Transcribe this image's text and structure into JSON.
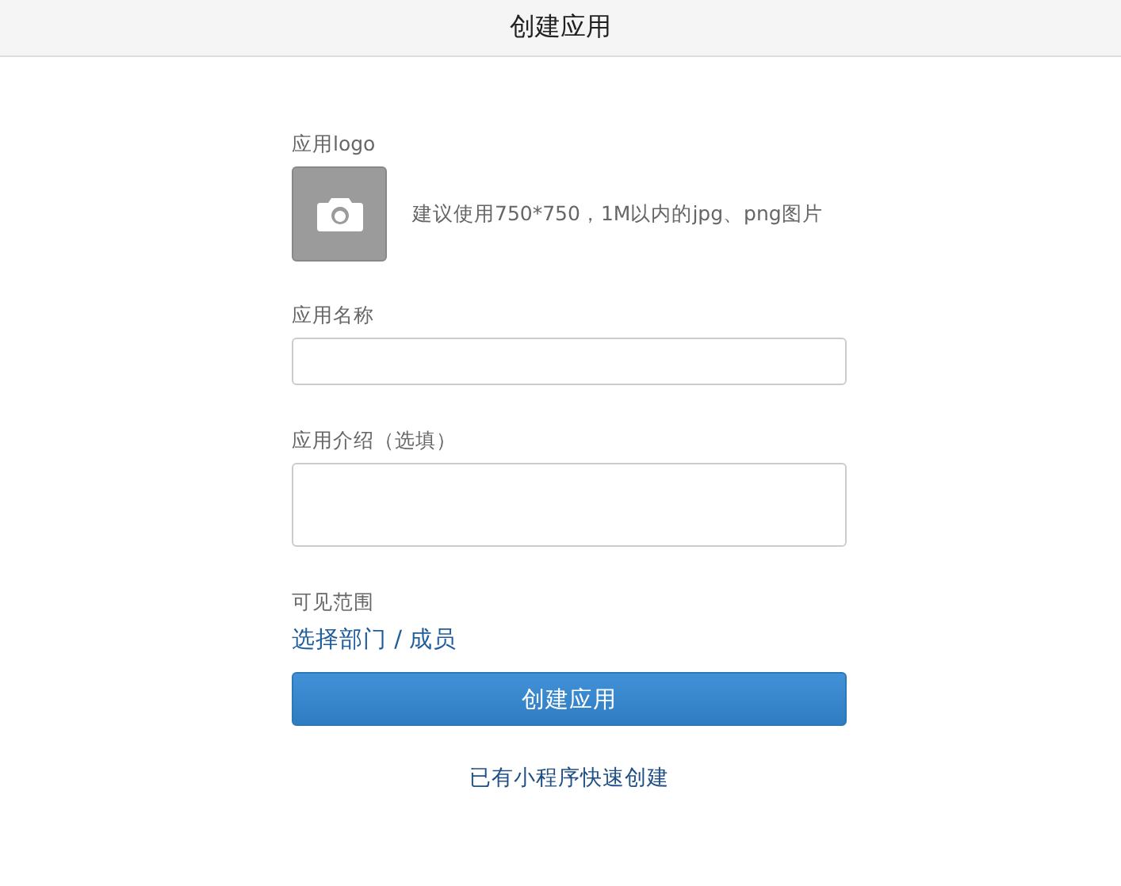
{
  "window": {
    "title": "创建应用"
  },
  "logo": {
    "label": "应用logo",
    "hint": "建议使用750*750，1M以内的jpg、png图片"
  },
  "name_field": {
    "label": "应用名称"
  },
  "intro_field": {
    "label": "应用介绍（选填）"
  },
  "visibility": {
    "label": "可见范围",
    "link": "选择部门 / 成员"
  },
  "submit_button": "创建应用",
  "quick_create_link": "已有小程序快速创建"
}
